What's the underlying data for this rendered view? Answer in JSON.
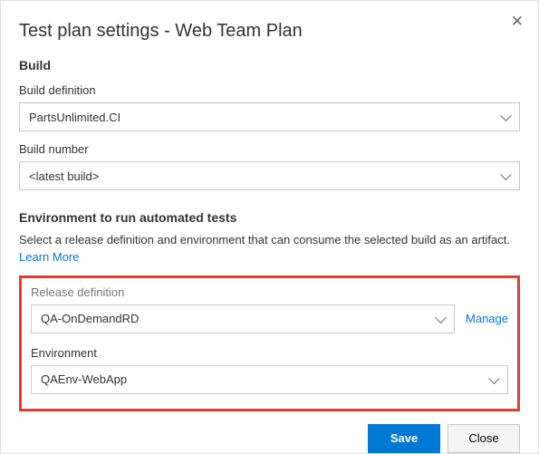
{
  "dialog": {
    "title": "Test plan settings - Web Team Plan"
  },
  "build": {
    "heading": "Build",
    "definition_label": "Build definition",
    "definition_value": "PartsUnlimited.CI",
    "number_label": "Build number",
    "number_value": "<latest build>"
  },
  "env": {
    "heading": "Environment to run automated tests",
    "helper_text": "Select a release definition and environment that can consume the selected build as an artifact.  ",
    "learn_more": "Learn More",
    "release_label": "Release definition",
    "release_value": "QA-OnDemandRD",
    "manage_link": "Manage",
    "environment_label": "Environment",
    "environment_value": "QAEnv-WebApp"
  },
  "footer": {
    "save": "Save",
    "close": "Close"
  }
}
